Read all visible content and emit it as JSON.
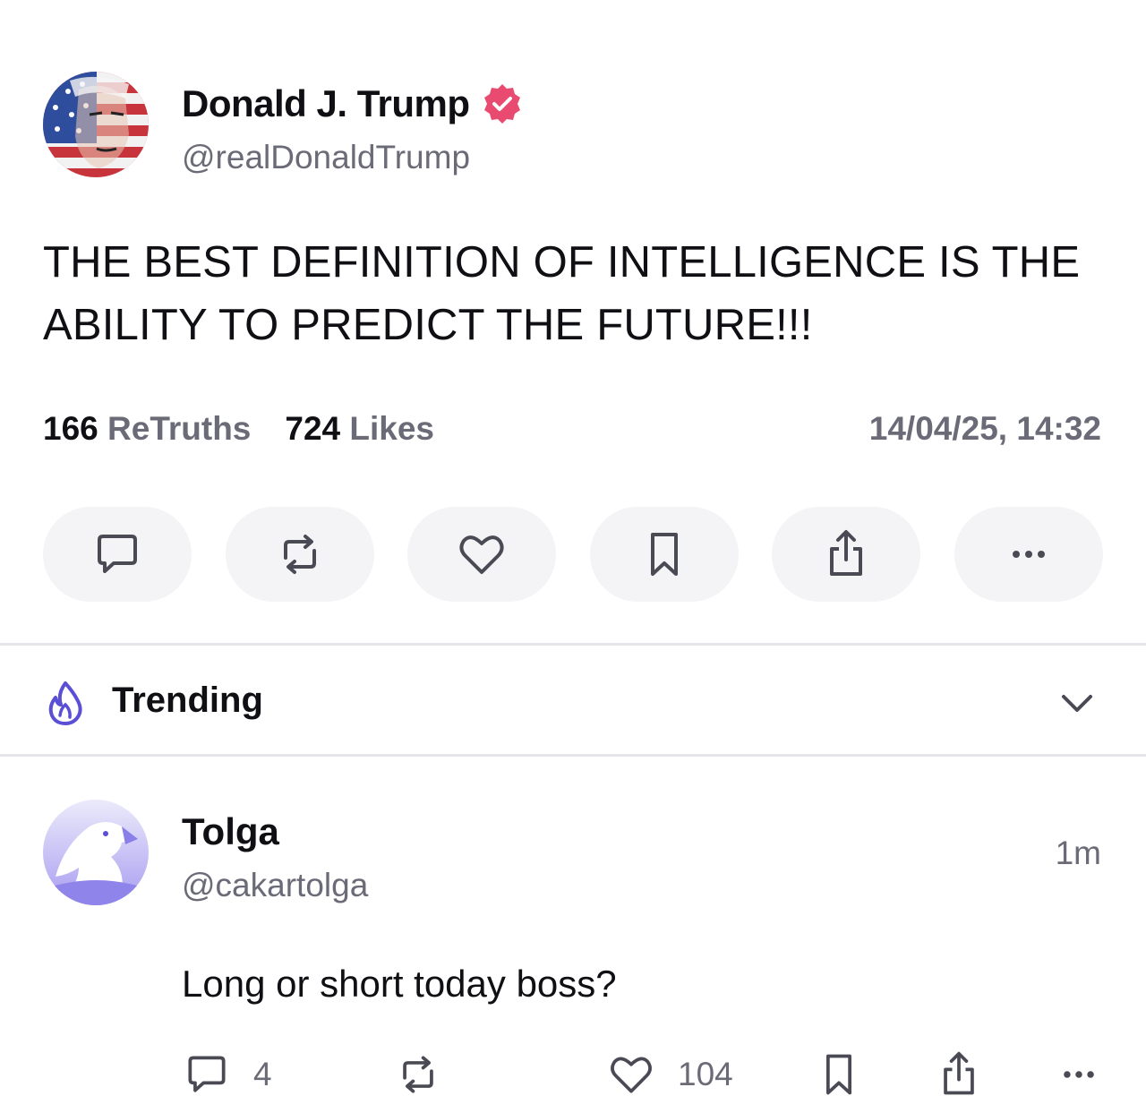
{
  "post": {
    "author_name": "Donald J. Trump",
    "author_handle": "@realDonaldTrump",
    "text": "THE BEST DEFINITION OF INTELLIGENCE IS THE ABILITY TO PREDICT THE FUTURE!!!",
    "retruths_count": "166",
    "retruths_label": "ReTruths",
    "likes_count": "724",
    "likes_label": "Likes",
    "timestamp": "14/04/25, 14:32",
    "actions": [
      "reply-icon",
      "retruth-icon",
      "like-icon",
      "bookmark-icon",
      "share-icon",
      "more-icon"
    ]
  },
  "trending": {
    "label": "Trending",
    "icon": "flame-icon"
  },
  "reply": {
    "author_name": "Tolga",
    "author_handle": "@cakartolga",
    "time": "1m",
    "text": "Long or short today boss?",
    "reply_count": "4",
    "like_count": "104"
  },
  "colors": {
    "verified": "#e94a6f",
    "accent_purple": "#5b4fd6",
    "muted_text": "#6b6b78",
    "pill_bg": "#f4f4f6"
  }
}
